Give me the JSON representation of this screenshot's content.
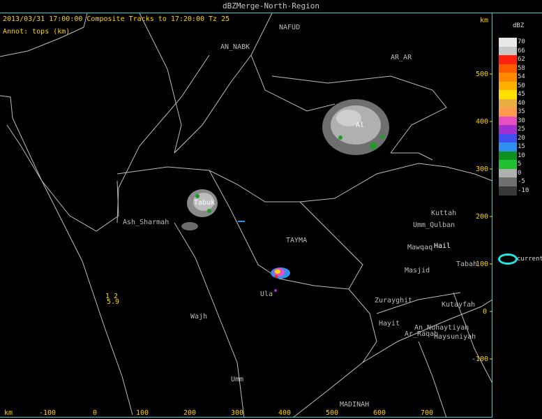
{
  "window": {
    "title": "dBZMerge-North-Region"
  },
  "header": {
    "timestamp_line": "2013/03/31 17:00:00  Composite Tracks to 17:20:00 Tz 25",
    "annot_line": "Annot: tops (km)"
  },
  "axes": {
    "unit_right": "km",
    "unit_bottom": "km",
    "x_ticks": [
      "-100",
      "0",
      "100",
      "200",
      "300",
      "400",
      "500",
      "600",
      "700"
    ],
    "y_ticks": [
      "500",
      "400",
      "300",
      "200",
      "100",
      "0",
      "-100"
    ]
  },
  "places": {
    "an_nabk": "AN_NABK",
    "ar_ar": "AR_AR",
    "tabuk": "Tabuk",
    "al_jawf_marker": "Al",
    "ash_sharmah": "Ash_Sharmah",
    "tayma": "TAYMA",
    "kuttah": "Kuttah",
    "umm_qulban": "Umm_Qulban",
    "mawqaq": "Mawqaq",
    "hail": "Hail",
    "tabah": "Tabah",
    "masjid": "Masjid",
    "ula": "Ula",
    "zurayghit": "Zurayghit",
    "kutayfah": "Kutayfah",
    "hayit": "Hayit",
    "an_nuhaytiyah": "An_Nuhaytiyah",
    "ar_raqab": "Ar_Raqab",
    "haysuniyah": "Haysuniyah",
    "wajh": "Wajh",
    "umm": "Umm",
    "madinah": "MADINAH",
    "top_label": "NAFUD"
  },
  "annotations": {
    "top_value": "5.9",
    "top_marker": "1 2"
  },
  "legend": {
    "unit": "dBZ",
    "levels": [
      {
        "label": "70",
        "color": "#e8e8e8"
      },
      {
        "label": "66",
        "color": "#c8c8c8"
      },
      {
        "label": "62",
        "color": "#ff2010"
      },
      {
        "label": "58",
        "color": "#ff5a00"
      },
      {
        "label": "54",
        "color": "#ff8a00"
      },
      {
        "label": "50",
        "color": "#ffb000"
      },
      {
        "label": "45",
        "color": "#ffe000"
      },
      {
        "label": "40",
        "color": "#e8b040"
      },
      {
        "label": "35",
        "color": "#ff9a50"
      },
      {
        "label": "30",
        "color": "#e850c0"
      },
      {
        "label": "25",
        "color": "#a030d0"
      },
      {
        "label": "20",
        "color": "#4050f0"
      },
      {
        "label": "15",
        "color": "#3090f0"
      },
      {
        "label": "10",
        "color": "#109020"
      },
      {
        "label": "5",
        "color": "#20c030"
      },
      {
        "label": "0",
        "color": "#b0b0b0"
      },
      {
        "label": "-5",
        "color": "#707070"
      },
      {
        "label": "-10",
        "color": "#383838"
      }
    ],
    "current_label": "current",
    "current_color": "#22e6e6"
  }
}
